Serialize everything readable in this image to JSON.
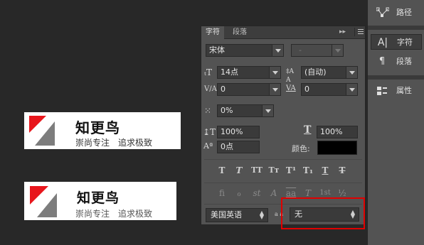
{
  "logos": [
    {
      "title": "知更鸟",
      "tagline_a": "崇尚专注",
      "tagline_b": "追求极致"
    },
    {
      "title": "知更鸟",
      "tagline_a": "崇尚专注",
      "tagline_b": "追求极致"
    }
  ],
  "colors": {
    "logo_red": "#e8161c",
    "logo_gray": "#7d7d7d",
    "panel_bg": "#535353",
    "highlight": "#e00000"
  },
  "character_panel": {
    "tabs": [
      "字符",
      "段落"
    ],
    "collapse_glyph": "▸▸",
    "font_family": "宋体",
    "font_style": "-",
    "font_size": "14点",
    "leading": "(自动)",
    "kerning": "0",
    "tracking": "0",
    "tsume": "0%",
    "vertical_scale": "100%",
    "horizontal_scale": "100%",
    "baseline_shift": "0点",
    "color_label": "颜色:",
    "color_value": "#000000",
    "style_buttons": [
      "T",
      "T",
      "TT",
      "Tт",
      "T¹",
      "T₁",
      "T",
      "T"
    ],
    "opentype_buttons": [
      "fi",
      "ℴ",
      "st",
      "A",
      "aa",
      "T",
      "1st",
      "½"
    ],
    "language": "美国英语",
    "aa_label": "a a",
    "antialias": "无",
    "icons": {
      "font_size": "tT",
      "leading": "A/A",
      "kerning": "V/A",
      "tracking": "VA",
      "tsume": "⁙",
      "vscale": "↕T",
      "hscale": "T",
      "baseline": "Aª"
    }
  },
  "dock": [
    {
      "icon": "path-icon",
      "label": "路径"
    },
    {
      "icon": "character-icon",
      "label": "字符"
    },
    {
      "icon": "paragraph-icon",
      "label": "段落"
    },
    {
      "icon": "properties-icon",
      "label": "属性"
    }
  ]
}
